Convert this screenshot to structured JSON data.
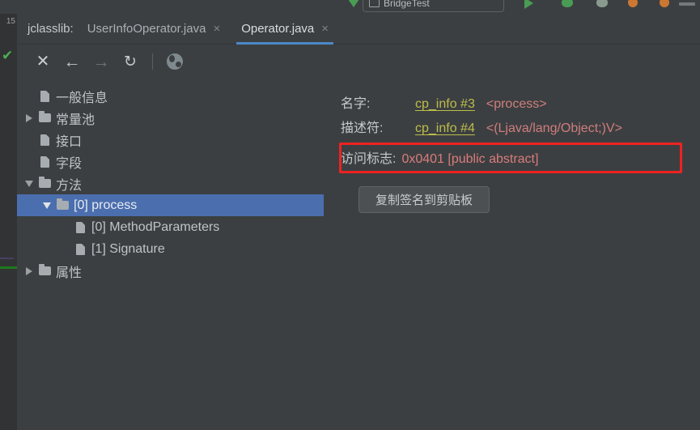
{
  "window": {
    "background": "#3c3f41",
    "accent_blue": "#4a88c7",
    "selection_blue": "#4b6eaf",
    "highlight_red": "#ee2222",
    "link_yellow": "#bdbd4a",
    "value_red": "#cf7e7e"
  },
  "top_toolbar": {
    "run_configuration": "BridgeTest",
    "icons": [
      "run-icon",
      "debug-icon",
      "coverage-icon",
      "profiler-icon",
      "attach-icon",
      "search-everywhere-icon"
    ]
  },
  "gutter": {
    "line_number": "15",
    "check_mark": "✔"
  },
  "tabs": {
    "prefix_label": "jclasslib:",
    "items": [
      {
        "label": "UserInfoOperator.java",
        "active": false,
        "close": "×"
      },
      {
        "label": "Operator.java",
        "active": true,
        "close": "×"
      }
    ]
  },
  "jclasslib_toolbar": {
    "close": "✕",
    "back": "←",
    "forward": "→",
    "reload": "↻",
    "browse_icon": "globe-icon"
  },
  "tree": {
    "items": [
      {
        "label": "一般信息",
        "indent": 0,
        "twisty": "none",
        "icon": "file",
        "selected": false
      },
      {
        "label": "常量池",
        "indent": 0,
        "twisty": "right",
        "icon": "folder",
        "selected": false
      },
      {
        "label": "接口",
        "indent": 0,
        "twisty": "none",
        "icon": "file",
        "selected": false
      },
      {
        "label": "字段",
        "indent": 0,
        "twisty": "none",
        "icon": "file",
        "selected": false
      },
      {
        "label": "方法",
        "indent": 0,
        "twisty": "down",
        "icon": "folder",
        "selected": false
      },
      {
        "label": "[0] process",
        "indent": 1,
        "twisty": "down",
        "icon": "folder",
        "selected": true
      },
      {
        "label": "[0] MethodParameters",
        "indent": 2,
        "twisty": "none",
        "icon": "file",
        "selected": false
      },
      {
        "label": "[1] Signature",
        "indent": 2,
        "twisty": "none",
        "icon": "file",
        "selected": false
      },
      {
        "label": "属性",
        "indent": 0,
        "twisty": "right",
        "icon": "folder",
        "selected": false
      }
    ]
  },
  "detail": {
    "name_label": "名字:",
    "name_link": "cp_info #3",
    "name_value": "<process>",
    "descriptor_label": "描述符:",
    "descriptor_link": "cp_info #4",
    "descriptor_value": "<(Ljava/lang/Object;)V>",
    "access_flags_label": "访问标志:",
    "access_flags_value": "0x0401 [public abstract]",
    "copy_button": "复制签名到剪贴板"
  }
}
